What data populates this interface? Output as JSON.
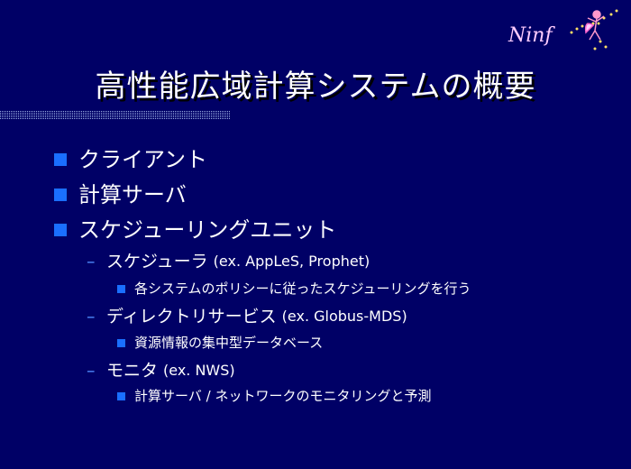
{
  "logo": {
    "text": "Ninf"
  },
  "title": "高性能広域計算システムの概要",
  "bullets": [
    {
      "text": "クライアント"
    },
    {
      "text": "計算サーバ"
    },
    {
      "text": "スケジューリングユニット"
    }
  ],
  "sub": [
    {
      "text": "スケジューラ",
      "ex": "(ex. AppLeS, Prophet)",
      "detail": "各システムのポリシーに従ったスケジューリングを行う"
    },
    {
      "text": "ディレクトリサービス",
      "ex": "(ex. Globus-MDS)",
      "detail": "資源情報の集中型データベース"
    },
    {
      "text": "モニタ",
      "ex": "(ex. NWS)",
      "detail": "計算サーバ / ネットワークのモニタリングと予測"
    }
  ],
  "colors": {
    "background": "#000066",
    "bullet": "#1a6fff",
    "text": "#ffffff",
    "logo": "#ffccff"
  }
}
